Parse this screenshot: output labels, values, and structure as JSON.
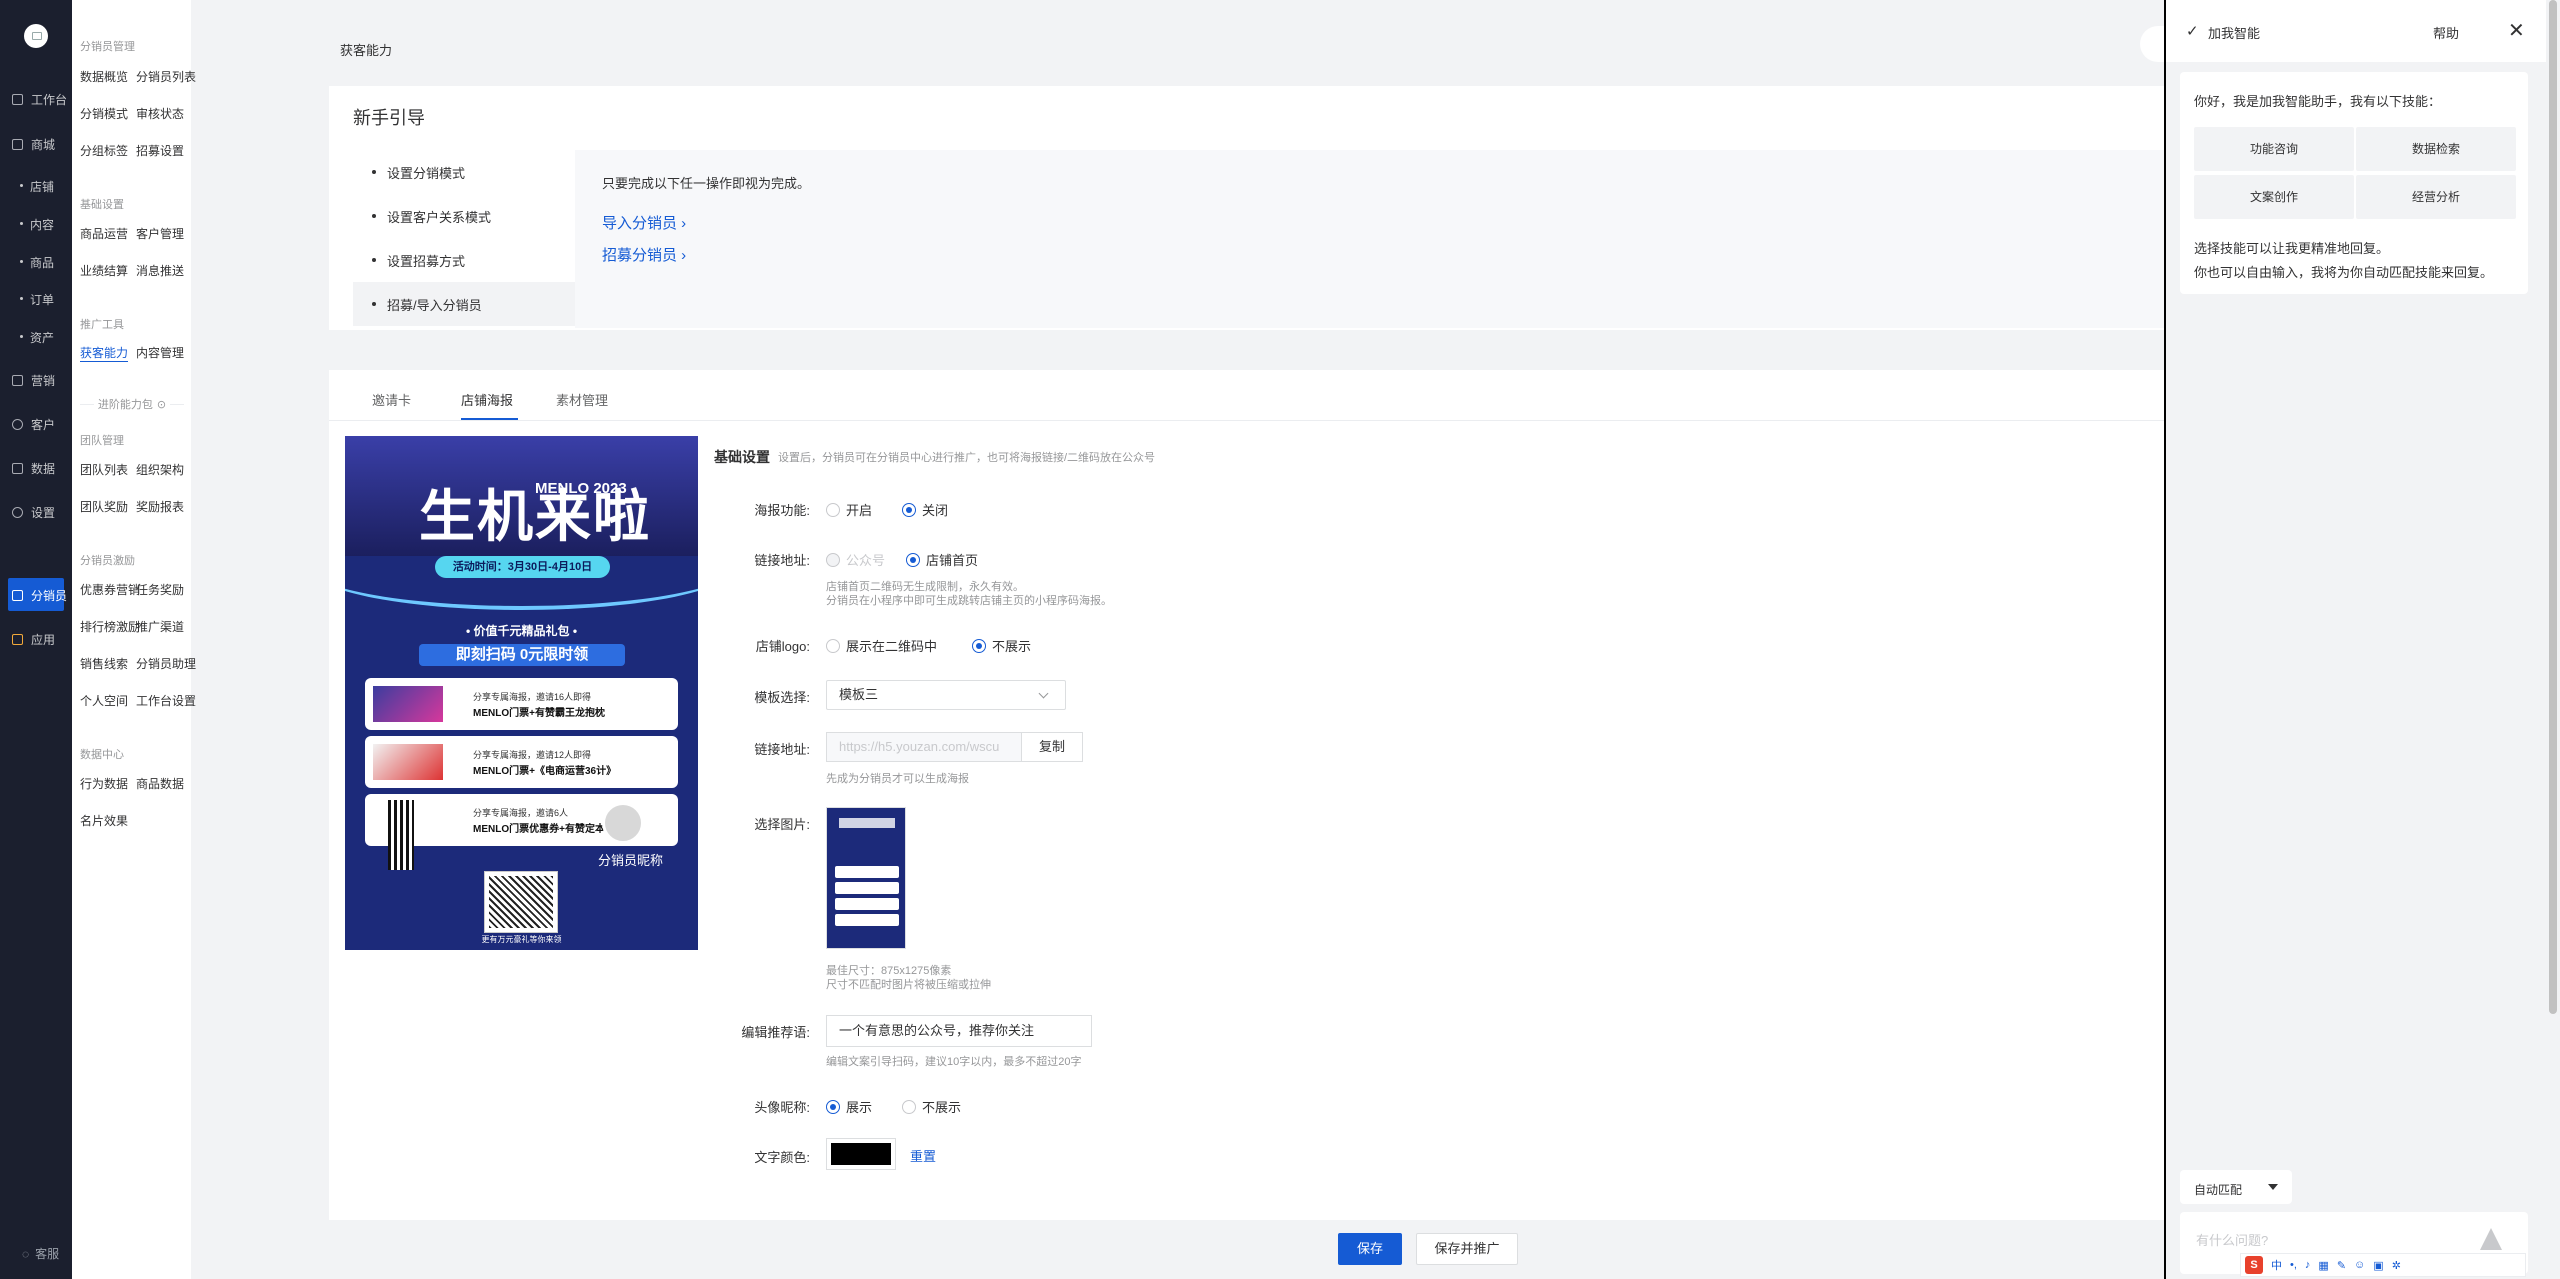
{
  "nav": {
    "items": [
      "工作台",
      "商城",
      "营销",
      "客户",
      "数据",
      "设置",
      "分销员",
      "应用"
    ],
    "mall_sub": [
      "店铺",
      "内容",
      "商品",
      "订单",
      "资产"
    ],
    "service": "客服"
  },
  "subnav": {
    "groups": [
      "分销员管理",
      "基础设置",
      "推广工具",
      "进阶能力包",
      "团队管理",
      "分销员激励",
      "数据中心"
    ],
    "items": [
      "数据概览",
      "分销员列表",
      "分销模式",
      "审核状态",
      "分组标签",
      "招募设置",
      "商品运营",
      "客户管理",
      "业绩结算",
      "消息推送",
      "获客能力",
      "内容管理",
      "团队列表",
      "组织架构",
      "团队奖励",
      "奖励报表",
      "优惠券营销",
      "任务奖励",
      "排行榜激励",
      "推广渠道",
      "销售线索",
      "分销员助理",
      "个人空间",
      "工作台设置",
      "行为数据",
      "商品数据",
      "名片效果"
    ]
  },
  "breadcrumb": "获客能力",
  "guide": {
    "title": "新手引导",
    "steps": [
      "设置分销模式",
      "设置客户关系模式",
      "设置招募方式",
      "招募/导入分销员"
    ],
    "note": "只要完成以下任一操作即视为完成。",
    "links": [
      "导入分销员 ›",
      "招募分销员 ›"
    ]
  },
  "tabs": [
    "邀请卡",
    "店铺海报",
    "素材管理"
  ],
  "poster": {
    "big_title": "生机来啦",
    "menlo": "MENLO 2023",
    "time": "活动时间：3月30日-4月10日",
    "gift": "• 价值千元精品礼包 •",
    "scan": "即刻扫码 0元限时领",
    "cards": [
      {
        "t1": "分享专属海报，邀请16人即得",
        "t2": "MENLO门票+有赞霸王龙抱枕"
      },
      {
        "t1": "分享专属海报，邀请12人即得",
        "t2": "MENLO门票+《电商运营36计》"
      },
      {
        "t1": "分享专属海报，邀请6人",
        "t2": "MENLO门票优惠券+有赞定本"
      }
    ],
    "nickname": "分销员昵称",
    "footer": "更有万元豪礼等你来领"
  },
  "form": {
    "section_title": "基础设置",
    "section_desc": "设置后，分销员可在分销员中心进行推广，也可将海报链接/二维码放在公众号",
    "poster_label": "海报功能:",
    "poster_opts": [
      "开启",
      "关闭"
    ],
    "link_label": "链接地址:",
    "link_opts": [
      "公众号",
      "店铺首页"
    ],
    "link_help1": "店铺首页二维码无生成限制，永久有效。",
    "link_help2": "分销员在小程序中即可生成跳转店铺主页的小程序码海报。",
    "logo_label": "店铺logo:",
    "logo_opts": [
      "展示在二维码中",
      "不展示"
    ],
    "tpl_label": "模板选择:",
    "tpl_value": "模板三",
    "url_label": "链接地址:",
    "url_value": "https://h5.youzan.com/wscu",
    "copy": "复制",
    "url_help": "先成为分销员才可以生成海报",
    "img_label": "选择图片:",
    "img_help1": "最佳尺寸：875x1275像素",
    "img_help2": "尺寸不匹配时图片将被压缩或拉伸",
    "rec_label": "编辑推荐语:",
    "rec_value": "一个有意思的公众号，推荐你关注",
    "rec_help": "编辑文案引导扫码，建议10字以内，最多不超过20字",
    "avatar_label": "头像昵称:",
    "avatar_opts": [
      "展示",
      "不展示"
    ],
    "color_label": "文字颜色:",
    "text_color": "#000000",
    "reset": "重置"
  },
  "footer": {
    "save": "保存",
    "save_promote": "保存并推广"
  },
  "assistant": {
    "title": "加我智能",
    "help": "帮助",
    "greeting": "你好，我是加我智能助手，我有以下技能：",
    "skills": [
      "功能咨询",
      "数据检索",
      "文案创作",
      "经营分析"
    ],
    "tip1": "选择技能可以让我更精准地回复。",
    "tip2": "你也可以自由输入，我将为你自动匹配技能来回复。",
    "mode": "自动匹配",
    "placeholder": "有什么问题?"
  },
  "ime": {
    "brand": "S",
    "lang": "中"
  }
}
